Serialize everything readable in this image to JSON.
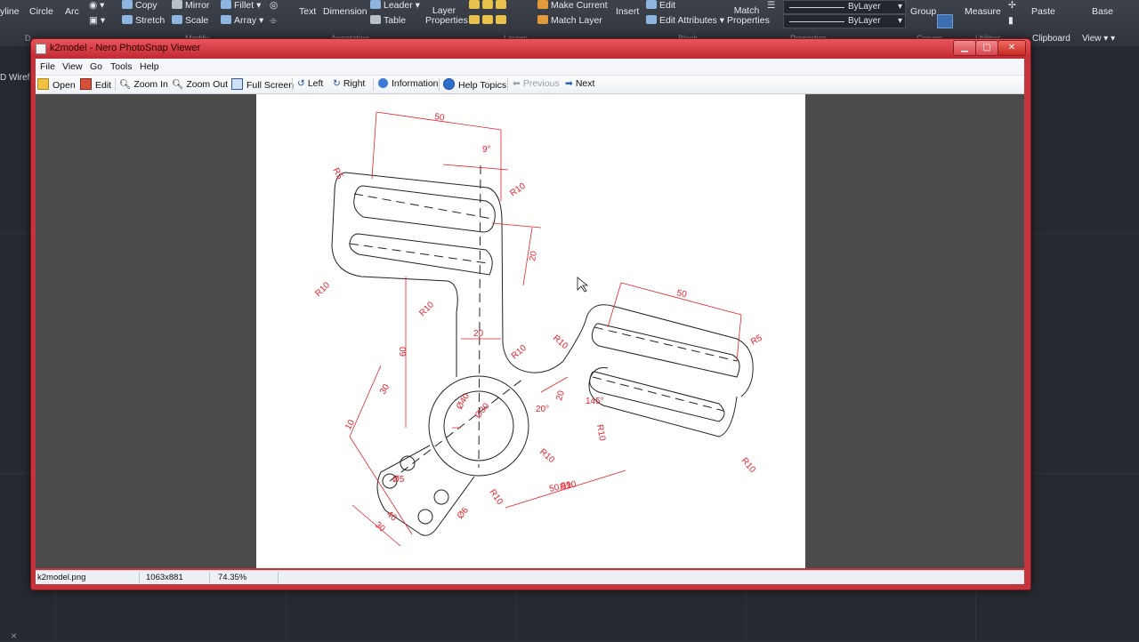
{
  "ribbon": {
    "draw": [
      "yline",
      "Circle",
      "Arc"
    ],
    "modify": [
      "Copy",
      "Mirror",
      "Fillet",
      "Stretch",
      "Scale",
      "Array"
    ],
    "annotation": [
      "Text",
      "Dimension",
      "Leader",
      "Table"
    ],
    "layers": [
      "Layer Properties",
      "Make Current",
      "Match Layer"
    ],
    "block": [
      "Insert",
      "Edit",
      "Edit Attributes"
    ],
    "properties": {
      "match": "Match Properties",
      "bylayer1": "ByLayer",
      "bylayer2": "ByLayer"
    },
    "groups": "Group",
    "utilities": "Measure",
    "clipboard": {
      "paste": "Paste",
      "label": "Clipboard"
    },
    "view": {
      "base": "Base",
      "label": "View"
    },
    "panel_labels": [
      "D",
      "Modify",
      "Annotation",
      "Layers",
      "Block",
      "Properties",
      "Groups",
      "Utilities"
    ]
  },
  "viewport_label": "D Wirefr",
  "window": {
    "title": "k2model - Nero PhotoSnap Viewer",
    "menu": [
      "File",
      "View",
      "Go",
      "Tools",
      "Help"
    ],
    "toolbar": {
      "open": "Open",
      "edit": "Edit",
      "zoom_in": "Zoom In",
      "zoom_out": "Zoom Out",
      "full_screen": "Full Screen",
      "left": "Left",
      "right": "Right",
      "information": "Information",
      "help_topics": "Help Topics",
      "previous": "Previous",
      "next": "Next"
    },
    "status": {
      "filename": "k2model.png",
      "dimensions": "1063x881",
      "zoom": "74.35%"
    }
  },
  "drawing": {
    "dims": [
      "50",
      "9°",
      "R5",
      "R10",
      "20",
      "R10",
      "R10",
      "60",
      "20",
      "R10",
      "R10",
      "50",
      "R5",
      "R10",
      "30",
      "10",
      "Ø40",
      "Ø30",
      "20°",
      "20",
      "145°",
      "R10",
      "R10",
      "R10",
      "Ø5",
      "R10",
      "50.59",
      "Ø6",
      "40",
      "30"
    ]
  },
  "colors": {
    "window_frame": "#c4343c",
    "dimension": "#e8202a",
    "geometry": "#222222",
    "cad_bg": "#262a30"
  }
}
